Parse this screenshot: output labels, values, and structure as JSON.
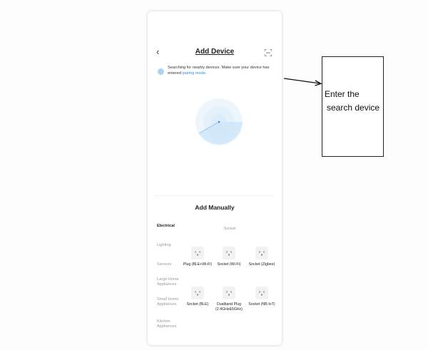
{
  "header": {
    "title": "Add Device",
    "back_icon": "chevron-left-icon",
    "scan_icon": "scan-icon"
  },
  "notice": {
    "text": "Searching for nearby devices. Make sure your device has entered",
    "link": "pairing mode",
    "suffix": "."
  },
  "manual": {
    "title": "Add Manually",
    "section_label": "Socket",
    "categories": [
      {
        "label": "Electrical",
        "active": true
      },
      {
        "label": "Lighting"
      },
      {
        "label": "Sensors"
      },
      {
        "label": "Large Home Appliances"
      },
      {
        "label": "Small Home Appliances"
      },
      {
        "label": "Kitchen Appliances"
      }
    ],
    "devices": [
      {
        "label": "Plug (BLE+Wi-Fi)"
      },
      {
        "label": "Socket (Wi-Fi)"
      },
      {
        "label": "Socket (Zigbee)"
      },
      {
        "label": "Socket (BLE)"
      },
      {
        "label": "Dualband Plug (2.4GHz&5GHz)"
      },
      {
        "label": "Socket (NB-IoT)"
      }
    ]
  },
  "annotation": {
    "line1": "Enter the",
    "line2": "search device"
  },
  "colors": {
    "accent": "#2f8de6",
    "radar": "#cfe6f8",
    "radar_sweep": "#8fc4ef"
  }
}
